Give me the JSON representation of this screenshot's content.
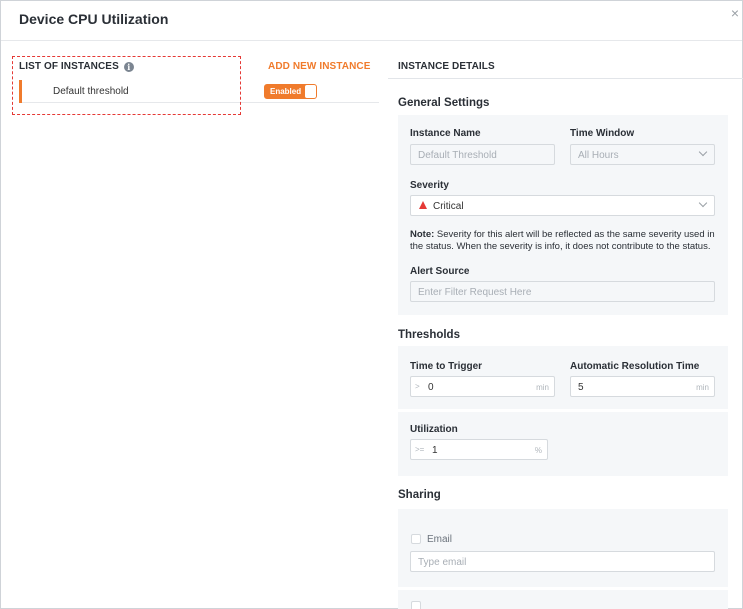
{
  "dialog": {
    "title": "Device CPU Utilization",
    "close_glyph": "×"
  },
  "columns": {
    "list_heading": "LIST OF INSTANCES",
    "add_link": "ADD NEW INSTANCE",
    "details_heading": "INSTANCE DETAILS"
  },
  "icons": {
    "info": "info-icon",
    "close": "close-icon",
    "severity": "warning-triangle-icon",
    "dropdown": "chevron-down-icon"
  },
  "instances": [
    {
      "name": "Default threshold",
      "status": "Enabled"
    }
  ],
  "general": {
    "title": "General Settings",
    "instance_name_label": "Instance Name",
    "instance_name_value": "Default Threshold",
    "time_window_label": "Time Window",
    "time_window_value": "All Hours",
    "severity_label": "Severity",
    "severity_value": "Critical",
    "note_bold": "Note:",
    "note_text": " Severity for this alert will be reflected as the same severity used in the status. When the severity is info, it does not contribute to the status.",
    "alert_source_label": "Alert Source",
    "alert_source_placeholder": "Enter Filter Request Here"
  },
  "thresholds": {
    "title": "Thresholds",
    "trigger_label": "Time to Trigger",
    "trigger_prefix": ">",
    "trigger_value": "0",
    "trigger_unit": "min",
    "resolution_label": "Automatic Resolution Time",
    "resolution_value": "5",
    "resolution_unit": "min",
    "utilization_label": "Utilization",
    "utilization_prefix": ">=",
    "utilization_value": "1",
    "utilization_unit": "%"
  },
  "sharing": {
    "title": "Sharing",
    "email_label": "Email",
    "email_placeholder": "Type email"
  },
  "colors": {
    "accent": "#f07b2c",
    "critical": "#e53935",
    "panel_bg": "#f5f7f9"
  }
}
